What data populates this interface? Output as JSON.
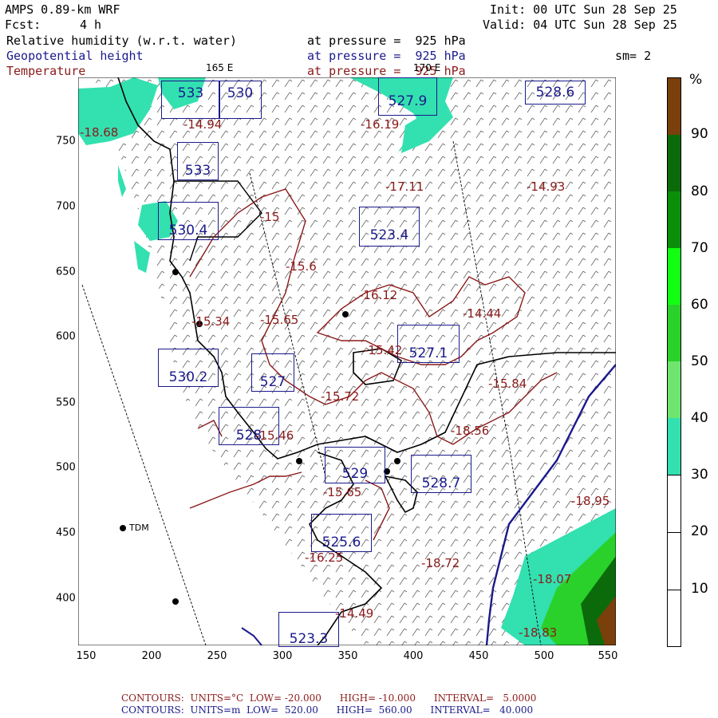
{
  "header": {
    "model": "AMPS 0.89-km WRF",
    "init": "Init: 00 UTC Sun 28 Sep 25",
    "fcst_label": "Fcst:",
    "fcst_value": "4 h",
    "valid": "Valid: 04 UTC Sun 28 Sep 25",
    "fields": [
      {
        "name": "Relative humidity (w.r.t. water)",
        "level": "at pressure =  925 hPa",
        "color": "#000000"
      },
      {
        "name": "Geopotential height",
        "level": "at pressure =  925 hPa",
        "color": "#1a1a8c"
      },
      {
        "name": "Temperature",
        "level": "at pressure =  925 hPa",
        "color": "#8b1a1a"
      }
    ],
    "smoothing": "sm= 2",
    "lon_label_left": "165 E",
    "lon_label_right": "170 E"
  },
  "axes": {
    "x_ticks": [
      "150",
      "200",
      "250",
      "300",
      "350",
      "400",
      "450",
      "500",
      "550"
    ],
    "y_ticks": [
      "750",
      "700",
      "650",
      "600",
      "550",
      "500",
      "450",
      "400"
    ]
  },
  "colorbar": {
    "unit": "%",
    "labels": [
      "90",
      "80",
      "70",
      "60",
      "50",
      "40",
      "30",
      "20",
      "10"
    ],
    "colors": [
      "#7a3f0a",
      "#0b6b0b",
      "#0b8f0b",
      "#12d412",
      "#2ad12a",
      "#6fe46f",
      "#33e0b0",
      "#ffffff",
      "#ffffff",
      "#ffffff"
    ]
  },
  "stations": [
    {
      "label": "TDM"
    }
  ],
  "height_labels": [
    "533",
    "530",
    "527.9",
    "528.6",
    "533",
    "530.4",
    "523.4",
    "527.1",
    "530.2",
    "527",
    "528",
    "529",
    "528.7",
    "525.6",
    "523.3"
  ],
  "temp_labels": [
    "-18.68",
    "-14.94",
    "-16.19",
    "-14.93",
    "-17.11",
    "-15",
    "-15.6",
    "-16.12",
    "-14.44",
    "-15.34",
    "-15.65",
    "-15.42",
    "-15.84",
    "-15.72",
    "-18.56",
    "-15.46",
    "-15.65",
    "-16.25",
    "-18.72",
    "-18.07",
    "-14.49",
    "-18.83",
    "-18.95"
  ],
  "footer": {
    "line1": "CONTOURS:  UNITS=°C  LOW= -20.000      HIGH= -10.000      INTERVAL=   5.0000",
    "line2": "CONTOURS:  UNITS=m  LOW=  520.00      HIGH=  560.00      INTERVAL=   40.000"
  }
}
